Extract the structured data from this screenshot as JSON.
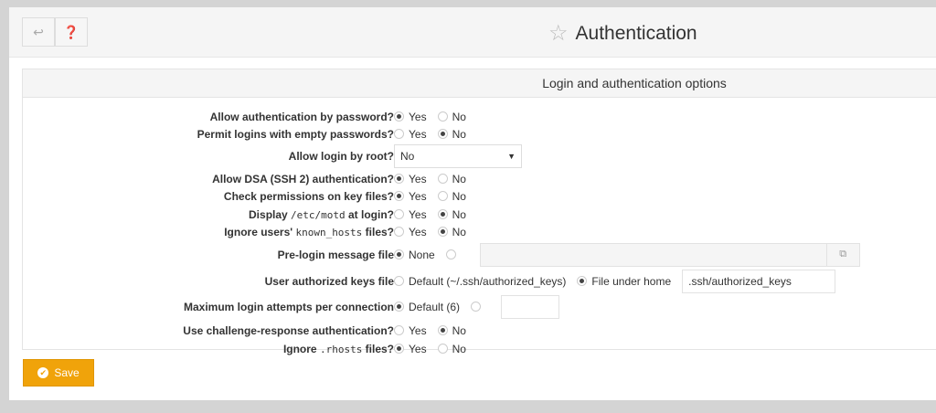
{
  "toolbar": {
    "back_icon": "return-arrow-icon",
    "help_icon": "question-circle-icon"
  },
  "header": {
    "title": "Authentication",
    "star_icon": "star-outline-icon"
  },
  "section": {
    "title": "Login and authentication options"
  },
  "rows": [
    {
      "label": "Allow authentication by password?",
      "options": [
        "Yes",
        "No"
      ],
      "selected": "Yes"
    },
    {
      "label": "Permit logins with empty passwords?",
      "options": [
        "Yes",
        "No"
      ],
      "selected": "No"
    },
    {
      "label": "Allow login by root?",
      "select_value": "No"
    },
    {
      "label": "Allow DSA (SSH 2) authentication?",
      "options": [
        "Yes",
        "No"
      ],
      "selected": "Yes"
    },
    {
      "label": "Check permissions on key files?",
      "options": [
        "Yes",
        "No"
      ],
      "selected": "Yes"
    },
    {
      "label_pre": "Display",
      "label_code": "/etc/motd",
      "label_post": "at login?",
      "options": [
        "Yes",
        "No"
      ],
      "selected": "No"
    },
    {
      "label_pre": "Ignore users'",
      "label_code": "known_hosts",
      "label_post": "files?",
      "options": [
        "Yes",
        "No"
      ],
      "selected": "No"
    },
    {
      "label": "Pre-login message file",
      "options": [
        "None",
        ""
      ],
      "selected": "None",
      "input_value": ""
    },
    {
      "label": "User authorized keys file",
      "options": [
        "Default (~/.ssh/authorized_keys)",
        "File under home"
      ],
      "selected": "File under home",
      "input_value": ".ssh/authorized_keys"
    },
    {
      "label": "Maximum login attempts per connection",
      "options": [
        "Default (6)",
        ""
      ],
      "selected": "Default (6)",
      "input_value": ""
    },
    {
      "label": "Use challenge-response authentication?",
      "options": [
        "Yes",
        "No"
      ],
      "selected": "No"
    },
    {
      "label_pre": "Ignore",
      "label_code": ".rhosts",
      "label_post": "files?",
      "options": [
        "Yes",
        "No"
      ],
      "selected": "Yes"
    }
  ],
  "save": {
    "label": "Save"
  }
}
